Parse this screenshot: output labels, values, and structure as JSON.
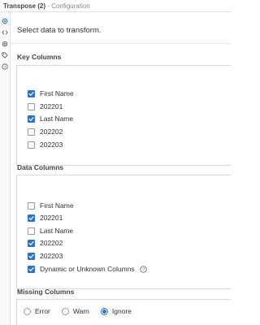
{
  "header": {
    "tool_name": "Transpose (2)",
    "separator": "-",
    "section": "Configuration"
  },
  "sidebar": {
    "icons": [
      "gear-icon",
      "code-icon",
      "cog-icon",
      "tag-icon",
      "help-icon"
    ],
    "active": "gear-icon"
  },
  "main": {
    "instruction": "Select data to transform."
  },
  "key_columns": {
    "label": "Key Columns",
    "items": [
      {
        "label": "First Name",
        "checked": true
      },
      {
        "label": "202201",
        "checked": false
      },
      {
        "label": "Last Name",
        "checked": true
      },
      {
        "label": "202202",
        "checked": false
      },
      {
        "label": "202203",
        "checked": false
      }
    ]
  },
  "data_columns": {
    "label": "Data Columns",
    "items": [
      {
        "label": "First Name",
        "checked": false
      },
      {
        "label": "202201",
        "checked": true
      },
      {
        "label": "Last Name",
        "checked": false
      },
      {
        "label": "202202",
        "checked": true
      },
      {
        "label": "202203",
        "checked": true
      },
      {
        "label": "Dynamic or Unknown Columns",
        "checked": true
      }
    ]
  },
  "missing_columns": {
    "label": "Missing Columns",
    "options": [
      {
        "label": "Error",
        "selected": false
      },
      {
        "label": "Warn",
        "selected": false
      },
      {
        "label": "Ignore",
        "selected": true
      }
    ]
  },
  "colors": {
    "accent": "#2f73c8",
    "border": "#d9d9d9",
    "text": "#333333"
  }
}
